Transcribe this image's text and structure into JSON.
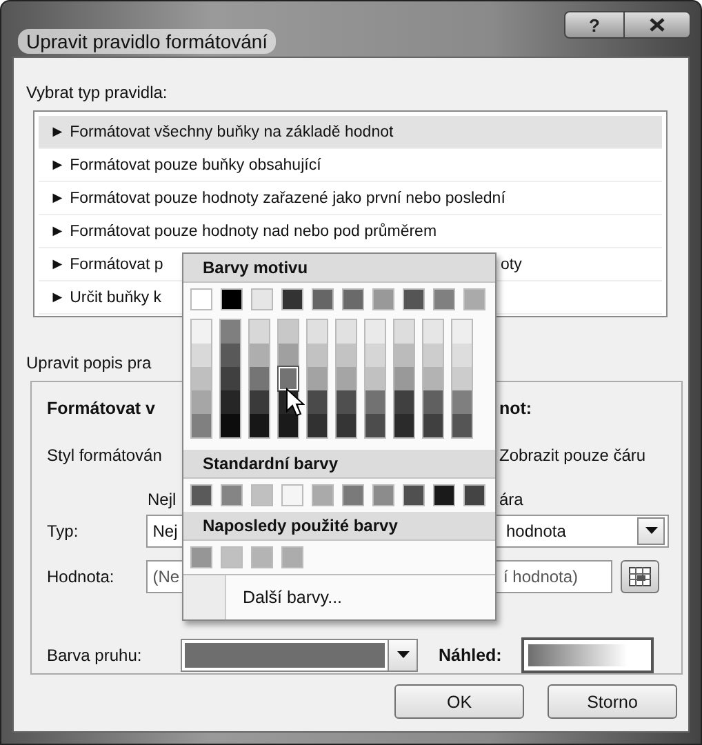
{
  "window": {
    "title": "Upravit pravidlo formátování",
    "help_button": "?"
  },
  "rule_type": {
    "label": "Vybrat typ pravidla:",
    "items": [
      {
        "label": "► Formátovat všechny buňky na základě hodnot",
        "selected": true
      },
      {
        "label": "► Formátovat pouze buňky obsahující",
        "selected": false
      },
      {
        "label": "► Formátovat pouze hodnoty zařazené jako první nebo poslední",
        "selected": false
      },
      {
        "label": "► Formátovat pouze hodnoty nad nebo pod průměrem",
        "selected": false
      },
      {
        "label": "► Formátovat p",
        "label_continued": "oty",
        "selected": false
      },
      {
        "label": "► Určit buňky k",
        "selected": false
      }
    ]
  },
  "rule_description": {
    "label": "Upravit popis pra",
    "heading": "Formátovat v",
    "heading_continued": "not:",
    "style_label": "Styl formátován",
    "show_bar_only": "Zobrazit pouze čáru",
    "min_column": "Nejl",
    "max_column": "ára",
    "type_label": "Typ:",
    "type_min": "Nej",
    "type_max": "hodnota",
    "value_label": "Hodnota:",
    "value_min": "(Ne",
    "value_max": "í hodnota)",
    "bar_color": {
      "label": "Barva pruhu:",
      "color": "#6e6e6e"
    },
    "preview_label": "Náhled:"
  },
  "buttons": [
    {
      "label": "OK"
    },
    {
      "label": "Storno"
    }
  ],
  "color_menu": {
    "theme_header": "Barvy motivu",
    "theme_colors": [
      {
        "color": "#ffffff",
        "selected": false
      },
      {
        "color": "#000000",
        "selected": false
      },
      {
        "color": "#e6e6e6",
        "selected": false
      },
      {
        "color": "#333333",
        "selected": false
      },
      {
        "color": "#666666",
        "selected": false
      },
      {
        "color": "#6a6a6a",
        "selected": false
      },
      {
        "color": "#999999",
        "selected": false
      },
      {
        "color": "#555555",
        "selected": false
      },
      {
        "color": "#808080",
        "selected": false
      },
      {
        "color": "#aaaaaa",
        "selected": false
      }
    ],
    "theme_shades": [
      {
        "shades": [
          {
            "color": "#f2f2f2",
            "selected": false
          },
          {
            "color": "#d9d9d9",
            "selected": false
          },
          {
            "color": "#bfbfbf",
            "selected": false
          },
          {
            "color": "#a6a6a6",
            "selected": false
          },
          {
            "color": "#808080",
            "selected": false
          }
        ]
      },
      {
        "shades": [
          {
            "color": "#7f7f7f",
            "selected": false
          },
          {
            "color": "#595959",
            "selected": false
          },
          {
            "color": "#404040",
            "selected": false
          },
          {
            "color": "#262626",
            "selected": false
          },
          {
            "color": "#0d0d0d",
            "selected": false
          }
        ]
      },
      {
        "shades": [
          {
            "color": "#d8d8d8",
            "selected": false
          },
          {
            "color": "#aeaeae",
            "selected": false
          },
          {
            "color": "#757575",
            "selected": false
          },
          {
            "color": "#3a3a3a",
            "selected": false
          },
          {
            "color": "#171717",
            "selected": false
          }
        ]
      },
      {
        "shades": [
          {
            "color": "#c8c8c8",
            "selected": false
          },
          {
            "color": "#a0a0a0",
            "selected": false
          },
          {
            "color": "#737373",
            "selected": true
          },
          {
            "color": "#262626",
            "selected": false
          },
          {
            "color": "#1a1a1a",
            "selected": false
          }
        ]
      },
      {
        "shades": [
          {
            "color": "#e0e0e0",
            "selected": false
          },
          {
            "color": "#c2c2c2",
            "selected": false
          },
          {
            "color": "#a3a3a3",
            "selected": false
          },
          {
            "color": "#4a4a4a",
            "selected": false
          },
          {
            "color": "#313131",
            "selected": false
          }
        ]
      },
      {
        "shades": [
          {
            "color": "#e1e1e1",
            "selected": false
          },
          {
            "color": "#c3c3c3",
            "selected": false
          },
          {
            "color": "#a5a5a5",
            "selected": false
          },
          {
            "color": "#4f4f4f",
            "selected": false
          },
          {
            "color": "#353535",
            "selected": false
          }
        ]
      },
      {
        "shades": [
          {
            "color": "#eaeaea",
            "selected": false
          },
          {
            "color": "#d6d6d6",
            "selected": false
          },
          {
            "color": "#c1c1c1",
            "selected": false
          },
          {
            "color": "#727272",
            "selected": false
          },
          {
            "color": "#4c4c4c",
            "selected": false
          }
        ]
      },
      {
        "shades": [
          {
            "color": "#dddddd",
            "selected": false
          },
          {
            "color": "#bbbbbb",
            "selected": false
          },
          {
            "color": "#999999",
            "selected": false
          },
          {
            "color": "#404040",
            "selected": false
          },
          {
            "color": "#2b2b2b",
            "selected": false
          }
        ]
      },
      {
        "shades": [
          {
            "color": "#e6e6e6",
            "selected": false
          },
          {
            "color": "#cdcdcd",
            "selected": false
          },
          {
            "color": "#b3b3b3",
            "selected": false
          },
          {
            "color": "#606060",
            "selected": false
          },
          {
            "color": "#404040",
            "selected": false
          }
        ]
      },
      {
        "shades": [
          {
            "color": "#eeeeee",
            "selected": false
          },
          {
            "color": "#dddddd",
            "selected": false
          },
          {
            "color": "#cccccc",
            "selected": false
          },
          {
            "color": "#7f7f7f",
            "selected": false
          },
          {
            "color": "#555555",
            "selected": false
          }
        ]
      }
    ],
    "standard_header": "Standardní barvy",
    "standard_colors": [
      {
        "color": "#5a5a5a",
        "selected": false
      },
      {
        "color": "#858585",
        "selected": false
      },
      {
        "color": "#c0c0c0",
        "selected": false
      },
      {
        "color": "#f5f5f5",
        "selected": false
      },
      {
        "color": "#aaaaaa",
        "selected": false
      },
      {
        "color": "#7a7a7a",
        "selected": false
      },
      {
        "color": "#8c8c8c",
        "selected": false
      },
      {
        "color": "#505050",
        "selected": false
      },
      {
        "color": "#1a1a1a",
        "selected": false
      },
      {
        "color": "#444444",
        "selected": false
      }
    ],
    "recent_header": "Naposledy použité barvy",
    "recent_colors": [
      {
        "color": "#969696",
        "selected": false
      },
      {
        "color": "#c0c0c0",
        "selected": false
      },
      {
        "color": "#b4b4b4",
        "selected": false
      },
      {
        "color": "#acacac",
        "selected": false
      }
    ],
    "more_colors": "Další barvy..."
  }
}
